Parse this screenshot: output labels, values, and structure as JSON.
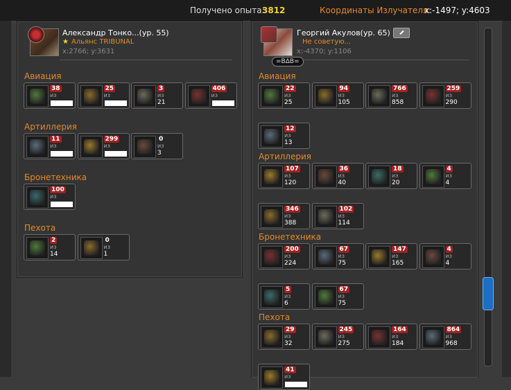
{
  "header": {
    "exp_label": "Получено опыта:",
    "exp_value": "3812",
    "coords_label": "Координаты Излучателя:",
    "coords_value": "x:-1497; y:4603"
  },
  "left_player": {
    "name": "Александр Тонко...(ур. 55)",
    "alliance": "Альянс TRIBUNAL",
    "coords": "x:2766; y:3631",
    "categories": [
      {
        "name": "Авиация",
        "units": [
          {
            "current": "38",
            "of": "из",
            "max": ""
          },
          {
            "current": "25",
            "of": "из",
            "max": ""
          },
          {
            "current": "3",
            "of": "из",
            "max": "21"
          },
          {
            "current": "406",
            "of": "из",
            "max": ""
          }
        ]
      },
      {
        "name": "Артиллерия",
        "units": [
          {
            "current": "11",
            "of": "из",
            "max": ""
          },
          {
            "current": "299",
            "of": "из",
            "max": ""
          },
          {
            "current": "0",
            "of": "из",
            "max": "3"
          }
        ]
      },
      {
        "name": "Бронетехника",
        "units": [
          {
            "current": "100",
            "of": "из",
            "max": ""
          }
        ]
      },
      {
        "name": "Пехота",
        "units": [
          {
            "current": "2",
            "of": "из",
            "max": "14"
          },
          {
            "current": "0",
            "of": "из",
            "max": "1"
          }
        ]
      }
    ]
  },
  "right_player": {
    "name": "Георгий Акулов(ур. 65)",
    "status": "Не советую...",
    "coords": "x:-4370; y:1106",
    "tag": "=ВΔВ=",
    "categories": [
      {
        "name": "Авиация",
        "units": [
          {
            "current": "22",
            "of": "из",
            "max": "25"
          },
          {
            "current": "94",
            "of": "из",
            "max": "105"
          },
          {
            "current": "766",
            "of": "из",
            "max": "858"
          },
          {
            "current": "259",
            "of": "из",
            "max": "290"
          },
          {
            "current": "12",
            "of": "из",
            "max": "13"
          }
        ]
      },
      {
        "name": "Артиллерия",
        "units": [
          {
            "current": "107",
            "of": "из",
            "max": "120"
          },
          {
            "current": "36",
            "of": "из",
            "max": "40"
          },
          {
            "current": "18",
            "of": "из",
            "max": "20"
          },
          {
            "current": "4",
            "of": "из",
            "max": "4"
          },
          {
            "current": "346",
            "of": "из",
            "max": "388"
          },
          {
            "current": "102",
            "of": "из",
            "max": "114"
          }
        ]
      },
      {
        "name": "Бронетехника",
        "units": [
          {
            "current": "200",
            "of": "из",
            "max": "224"
          },
          {
            "current": "67",
            "of": "из",
            "max": "75"
          },
          {
            "current": "147",
            "of": "из",
            "max": "165"
          },
          {
            "current": "4",
            "of": "из",
            "max": "4"
          },
          {
            "current": "5",
            "of": "из",
            "max": "6"
          },
          {
            "current": "67",
            "of": "из",
            "max": "75"
          }
        ]
      },
      {
        "name": "Пехота",
        "units": [
          {
            "current": "29",
            "of": "из",
            "max": "32"
          },
          {
            "current": "245",
            "of": "из",
            "max": "275"
          },
          {
            "current": "164",
            "of": "из",
            "max": "184"
          },
          {
            "current": "864",
            "of": "из",
            "max": "968"
          },
          {
            "current": "41",
            "of": "из",
            "max": ""
          }
        ]
      }
    ]
  },
  "colors": {
    "accent_orange": "#e58a2a",
    "exp_yellow": "#f2d23c",
    "badge_red": "#a52020",
    "scroll_blue": "#1e6fbf"
  }
}
